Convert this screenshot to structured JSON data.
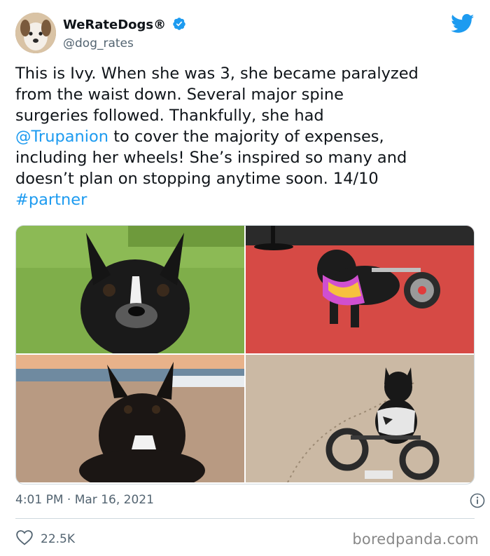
{
  "author": {
    "name": "WeRateDogs®",
    "handle": "@dog_rates"
  },
  "tweet": {
    "text_1": "This is Ivy. When she was 3, she became paralyzed\nfrom the waist down. Several major spine\nsurgeries followed. Thankfully, she had\n",
    "mention": "@Trupanion",
    "text_2": " to cover the majority of expenses,\nincluding her wheels! She’s inspired so many and\ndoesn’t plan on stopping anytime soon. 14/10\n",
    "hashtag": "#partner"
  },
  "meta": {
    "time": "4:01 PM",
    "separator": " · ",
    "date": "Mar 16, 2021"
  },
  "engagement": {
    "likes": "22.5K"
  },
  "watermark": "boredpanda.com",
  "colors": {
    "link": "#1d9bf0",
    "verified": "#1d9bf0",
    "secondary_text": "#536471"
  },
  "icons": {
    "verified": "verified-badge-icon",
    "twitter": "twitter-bird-icon",
    "info": "info-icon",
    "like": "heart-icon"
  }
}
